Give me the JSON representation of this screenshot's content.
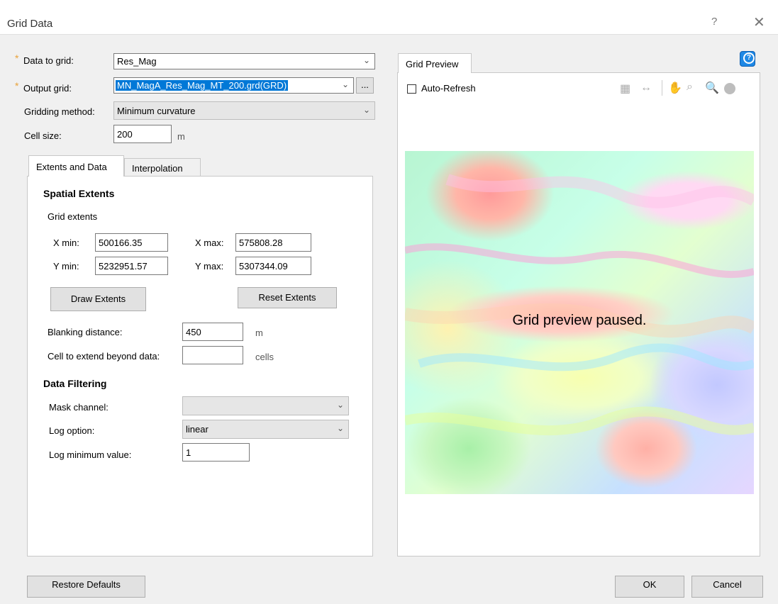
{
  "window": {
    "title": "Grid Data",
    "help_symbol": "?",
    "close_symbol": "✕"
  },
  "form": {
    "required_marker": "*",
    "data_to_grid": {
      "label": "Data to grid:",
      "value": "Res_Mag"
    },
    "output_grid": {
      "label": "Output grid:",
      "value": "MN_MagA_Res_Mag_MT_200.grd(GRD)",
      "browse_label": "..."
    },
    "gridding_method": {
      "label": "Gridding method:",
      "value": "Minimum curvature"
    },
    "cell_size": {
      "label": "Cell size:",
      "value": "200",
      "unit": "m"
    }
  },
  "tabs": [
    {
      "label": "Extents and Data",
      "active": true
    },
    {
      "label": "Interpolation",
      "active": false
    }
  ],
  "extents": {
    "section_title": "Spatial Extents",
    "subtitle": "Grid extents",
    "xmin": {
      "label": "X min:",
      "value": "500166.35"
    },
    "xmax": {
      "label": "X max:",
      "value": "575808.28"
    },
    "ymin": {
      "label": "Y min:",
      "value": "5232951.57"
    },
    "ymax": {
      "label": "Y max:",
      "value": "5307344.09"
    },
    "draw_button": "Draw Extents",
    "reset_button": "Reset Extents",
    "blanking": {
      "label": "Blanking distance:",
      "value": "450",
      "unit": "m"
    },
    "extend": {
      "label": "Cell to extend beyond data:",
      "value": "",
      "unit": "cells"
    }
  },
  "filtering": {
    "section_title": "Data Filtering",
    "mask_channel": {
      "label": "Mask channel:",
      "value": ""
    },
    "log_option": {
      "label": "Log option:",
      "value": "linear"
    },
    "log_min": {
      "label": "Log minimum value:",
      "value": "1"
    }
  },
  "preview": {
    "tab_label": "Grid Preview",
    "auto_refresh_label": "Auto-Refresh",
    "auto_refresh_checked": false,
    "paused_text": "Grid preview paused.",
    "tools": [
      "grid-points-icon",
      "extent-icon",
      "pan-hand-icon",
      "zoom-extent-icon",
      "zoom-icon",
      "refresh-icon"
    ]
  },
  "footer": {
    "restore_defaults": "Restore Defaults",
    "ok": "OK",
    "cancel": "Cancel"
  },
  "colors": {
    "accent": "#0078d7",
    "required": "#e8a23a",
    "help_icon": "#1e88e5"
  }
}
